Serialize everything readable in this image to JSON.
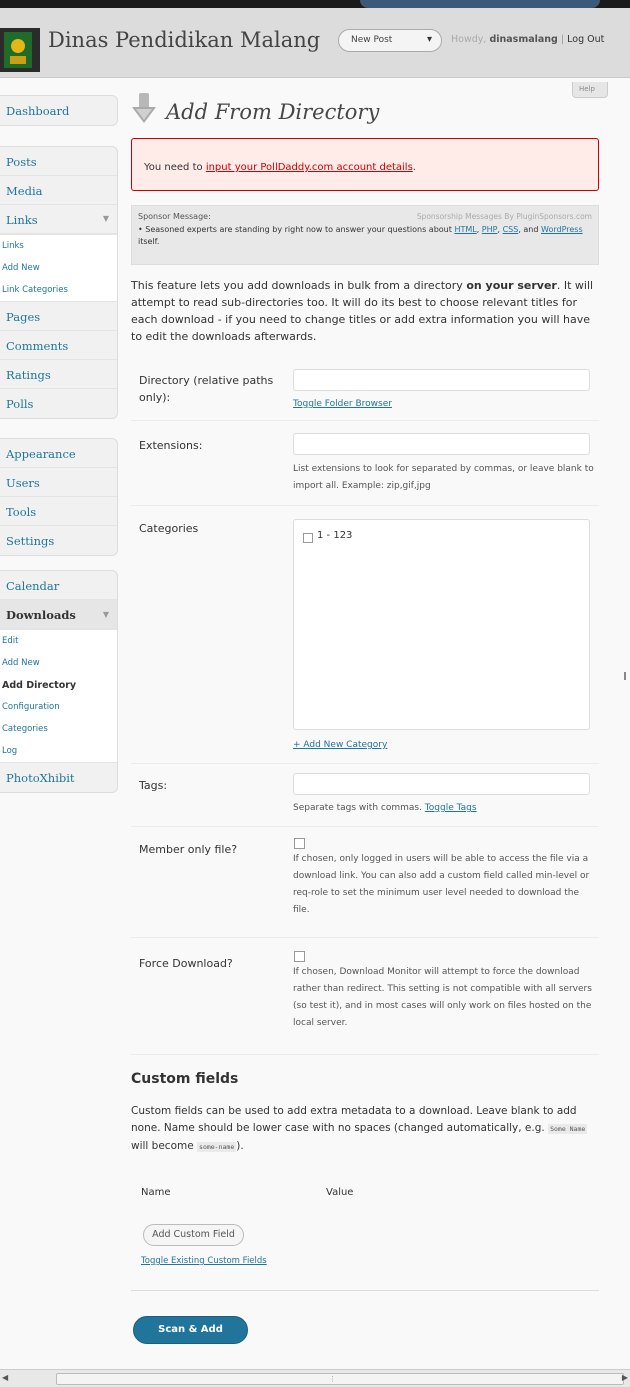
{
  "header": {
    "site_title": "Dinas Pendidikan Malang",
    "new_post": "New Post",
    "howdy_prefix": "Howdy,",
    "username": "dinasmalang",
    "logout": "Log Out",
    "help": "Help"
  },
  "sidebar": {
    "group1": [
      "Dashboard"
    ],
    "group2": {
      "items": [
        "Posts",
        "Media",
        "Links"
      ],
      "links_sub": [
        "Links",
        "Add New",
        "Link Categories"
      ],
      "items_after": [
        "Pages",
        "Comments",
        "Ratings",
        "Polls"
      ]
    },
    "group3": [
      "Appearance",
      "Users",
      "Tools",
      "Settings"
    ],
    "group4": {
      "calendar": "Calendar",
      "downloads": "Downloads",
      "downloads_sub": [
        "Edit",
        "Add New",
        "Add Directory",
        "Configuration",
        "Categories",
        "Log"
      ],
      "photoxhibit": "PhotoXhibit"
    }
  },
  "page": {
    "title": "Add From Directory",
    "error_prefix": "You need to ",
    "error_link": "input your PollDaddy.com account details",
    "error_suffix": ".",
    "sponsor_label": "Sponsor Message:",
    "sponsor_right": "Sponsorship Messages By PluginSponsors.com",
    "sponsor_pre": "• Seasoned experts are standing by right now to answer your questions about ",
    "sponsor_html": "HTML",
    "sponsor_php": "PHP",
    "sponsor_css": "CSS",
    "sponsor_and": ", and ",
    "sponsor_wp": "WordPress",
    "sponsor_itself": " itself.",
    "intro_1": "This feature lets you add downloads in bulk from a directory ",
    "intro_bold": "on your server",
    "intro_2": ". It will attempt to read sub-directories too. It will do its best to choose relevant titles for each download - if you need to change titles or add extra information you will have to edit the downloads afterwards."
  },
  "form": {
    "directory_label": "Directory (relative paths only):",
    "directory_value": "",
    "toggle_folder": "Toggle Folder Browser",
    "extensions_label": "Extensions:",
    "extensions_value": "",
    "extensions_desc": "List extensions to look for separated by commas, or leave blank to import all. Example: zip,gif,jpg",
    "categories_label": "Categories",
    "category_item": "1 - 123",
    "add_category": "+ Add New Category",
    "tags_label": "Tags:",
    "tags_value": "",
    "tags_desc": "Separate tags with commas. ",
    "toggle_tags": "Toggle Tags",
    "member_label": "Member only file?",
    "member_desc": "If chosen, only logged in users will be able to access the file via a download link. You can also add a custom field called min-level or req-role to set the minimum user level needed to download the file.",
    "force_label": "Force Download?",
    "force_desc": "If chosen, Download Monitor will attempt to force the download rather than redirect. This setting is not compatible with all servers (so test it), and in most cases will only work on files hosted on the local server."
  },
  "custom_fields": {
    "heading": "Custom fields",
    "desc_1": "Custom fields can be used to add extra metadata to a download. Leave blank to add none. Name should be lower case with no spaces (changed automatically, e.g. ",
    "code_1": "Some Name",
    "desc_2": " will become ",
    "code_2": "some-name",
    "desc_3": ").",
    "col_name": "Name",
    "col_value": "Value",
    "add_button": "Add Custom Field",
    "toggle_existing": "Toggle Existing Custom Fields"
  },
  "submit": {
    "label": "Scan & Add"
  },
  "colors": {
    "accent": "#21759b",
    "error_bg": "#ffebe8",
    "error_border": "#cc0000"
  }
}
